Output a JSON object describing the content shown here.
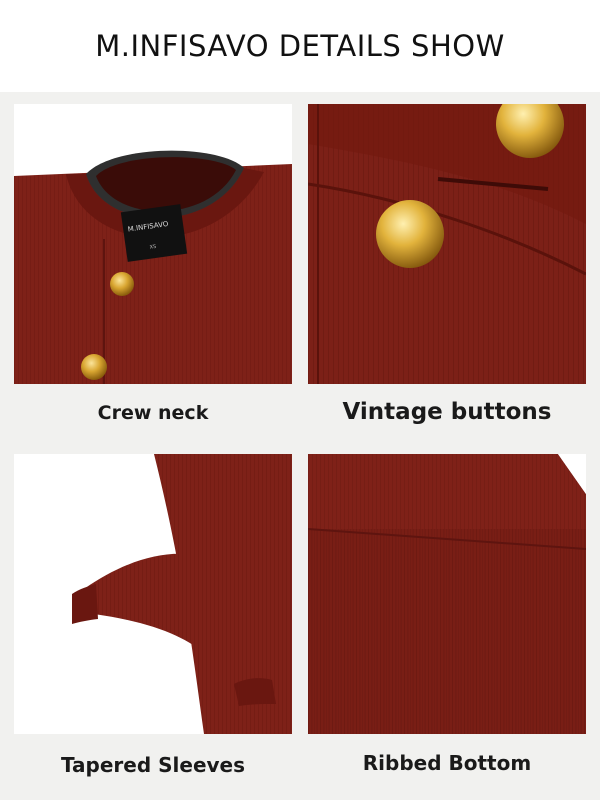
{
  "header": {
    "title": "M.INFISAVO DETAILS SHOW"
  },
  "panels": [
    {
      "caption": "Crew neck",
      "label_brand": "M.INFISAVO",
      "label_size": "XS"
    },
    {
      "caption": "Vintage buttons"
    },
    {
      "caption": "Tapered Sleeves"
    },
    {
      "caption": "Ribbed Bottom"
    }
  ],
  "colors": {
    "knit": "#7e2118",
    "knit_dark": "#5e140f",
    "gold": "#d9a631",
    "background": "#f1f1ef"
  }
}
